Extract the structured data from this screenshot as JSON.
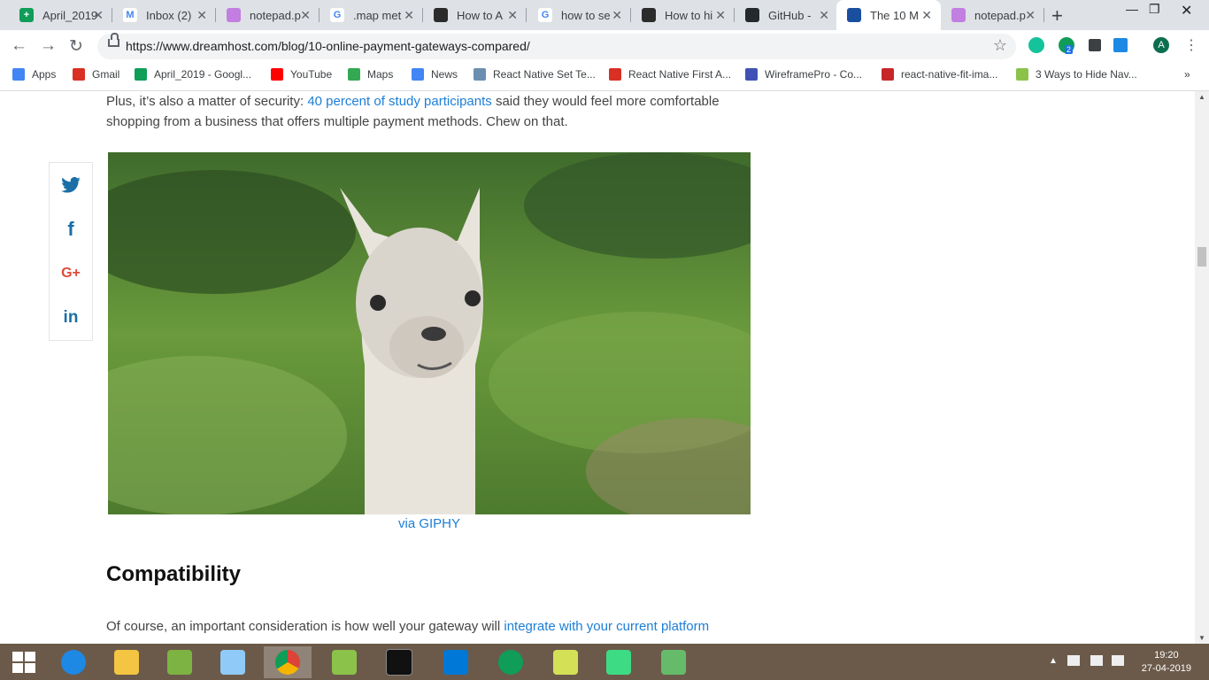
{
  "tabs": [
    {
      "title": "April_2019",
      "fav_color": "#0f9d58",
      "fav": "+"
    },
    {
      "title": "Inbox (2)",
      "fav_color": "#ffffff",
      "fav": "M"
    },
    {
      "title": "notepad.p",
      "fav_color": "#c27ee0",
      "fav": ""
    },
    {
      "title": ".map met",
      "fav_color": "#ffffff",
      "fav": "G"
    },
    {
      "title": "How to A",
      "fav_color": "#2b2b2b",
      "fav": ""
    },
    {
      "title": "how to se",
      "fav_color": "#ffffff",
      "fav": "G"
    },
    {
      "title": "How to hi",
      "fav_color": "#2b2b2b",
      "fav": ""
    },
    {
      "title": "GitHub - ",
      "fav_color": "#24292e",
      "fav": ""
    },
    {
      "title": "The 10 M",
      "fav_color": "#1a4fa0",
      "fav": "",
      "active": true
    },
    {
      "title": "notepad.p",
      "fav_color": "#c27ee0",
      "fav": ""
    }
  ],
  "toolbar": {
    "url": "https://www.dreamhost.com/blog/10-online-payment-gateways-compared/",
    "profile_initial": "A",
    "ext_badge": "2"
  },
  "bookmarks": [
    {
      "label": "Apps",
      "color": "#4285f4"
    },
    {
      "label": "Gmail",
      "color": "#d93025"
    },
    {
      "label": "April_2019 - Googl...",
      "color": "#0f9d58"
    },
    {
      "label": "YouTube",
      "color": "#ff0000"
    },
    {
      "label": "Maps",
      "color": "#34a853"
    },
    {
      "label": "News",
      "color": "#4285f4"
    },
    {
      "label": "React Native Set Te...",
      "color": "#6a8fb0"
    },
    {
      "label": "React Native First A...",
      "color": "#d93025"
    },
    {
      "label": "WireframePro - Co...",
      "color": "#3f51b5"
    },
    {
      "label": "react-native-fit-ima...",
      "color": "#c62828"
    },
    {
      "label": "3 Ways to Hide Nav...",
      "color": "#8bc34a"
    }
  ],
  "article": {
    "intro_text_1": "Plus, it’s also a matter of security: ",
    "intro_link": "40 percent of study participants",
    "intro_text_2": " said they would feel more comfortable shopping from a business that offers multiple payment methods. Chew on that.",
    "image_caption": "via GIPHY",
    "heading": "Compatibility",
    "p2_text": "Of course, an important consideration is how well your gateway will ",
    "p2_link": "integrate with your current platform"
  },
  "share_icons": [
    "twitter-icon",
    "facebook-icon",
    "google-plus-icon",
    "linkedin-icon"
  ],
  "share_labels": {
    "twitter": "🐦",
    "facebook": "f",
    "googleplus": "G+",
    "linkedin": "in"
  },
  "taskbar": {
    "time": "19:20",
    "date": "27-04-2019"
  }
}
